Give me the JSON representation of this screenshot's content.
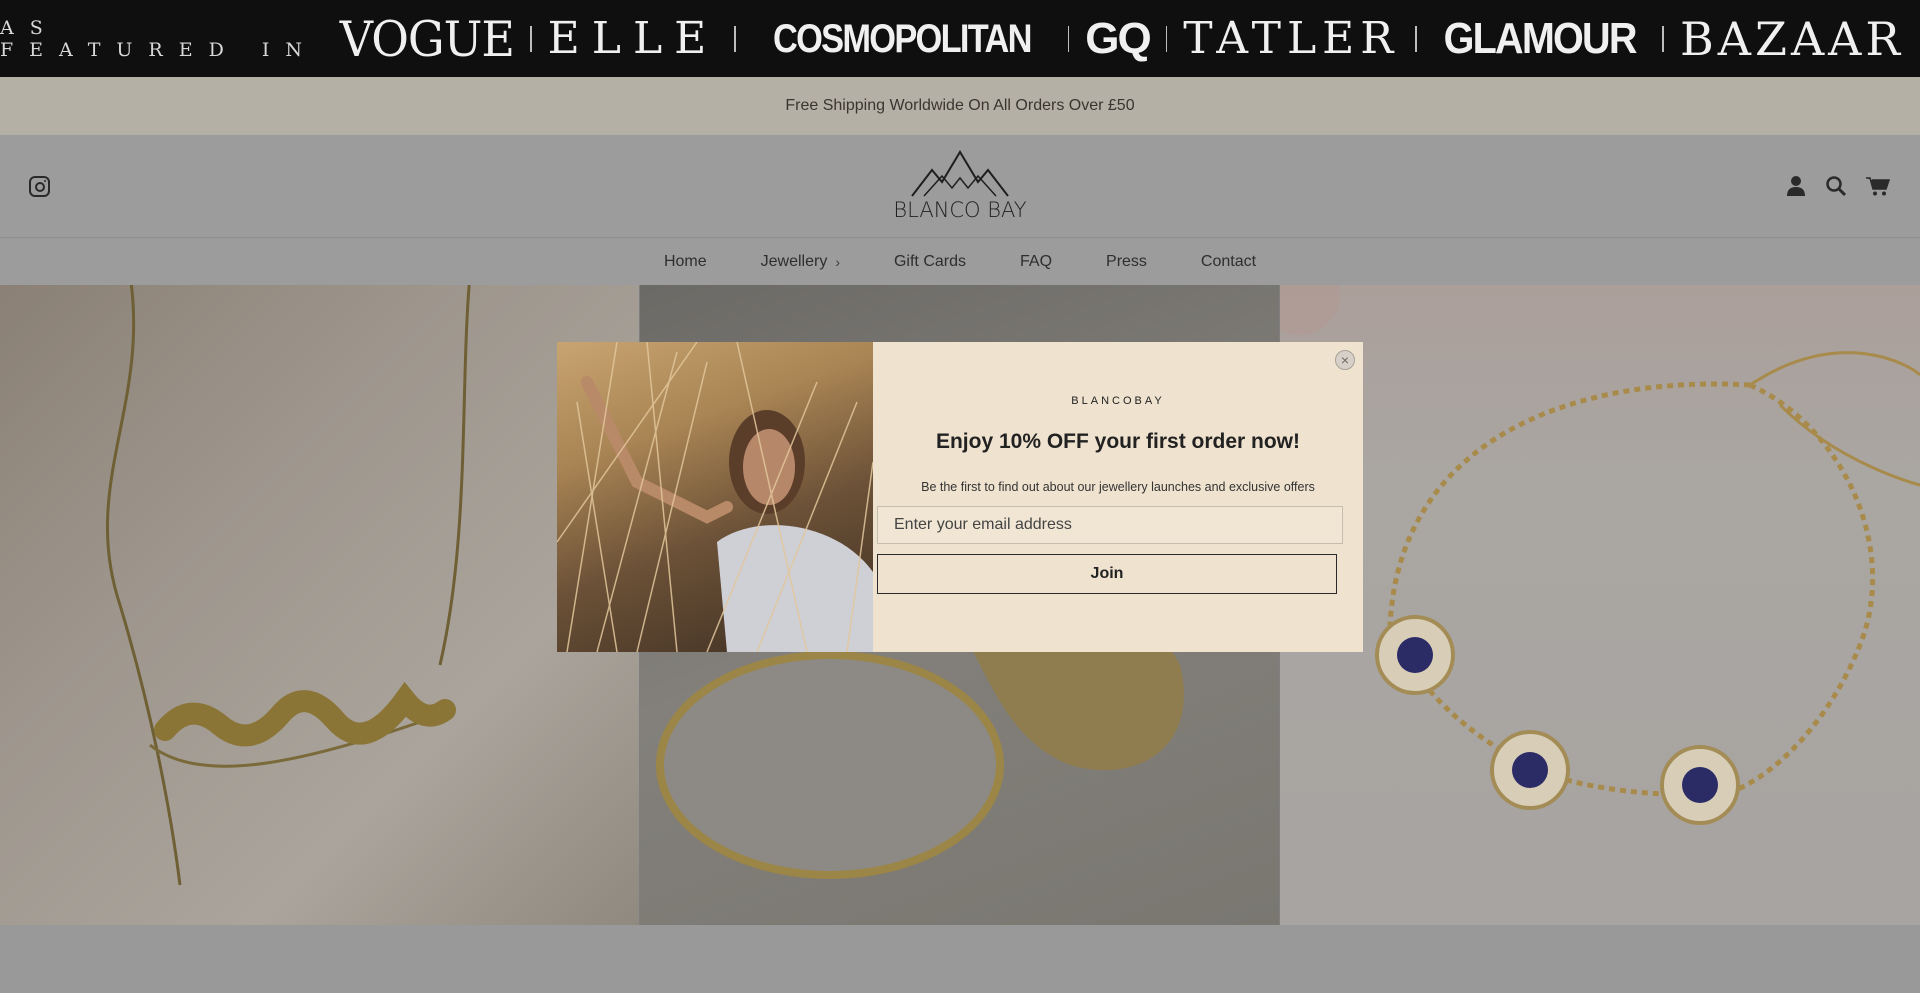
{
  "featured": {
    "prefix": "AS FEATURED IN",
    "logos": [
      "VOGUE",
      "ELLE",
      "COSMOPOLITAN",
      "GQ",
      "TATLER",
      "GLAMOUR",
      "BAZAAR"
    ]
  },
  "announcement": {
    "text": "Free Shipping Worldwide On All Orders Over £50"
  },
  "header": {
    "brand_name": "BLANCO BAY",
    "icons": [
      "instagram-icon",
      "account-icon",
      "search-icon",
      "cart-icon"
    ]
  },
  "nav": {
    "items": [
      {
        "label": "Home"
      },
      {
        "label": "Jewellery"
      },
      {
        "label": "Gift Cards"
      },
      {
        "label": "FAQ"
      },
      {
        "label": "Press"
      },
      {
        "label": "Contact"
      }
    ]
  },
  "modal": {
    "brand": "BLANCOBAY",
    "heading": "Enjoy 10% OFF your first order now!",
    "subtext": "Be the first to find out about our jewellery launches and exclusive offers",
    "email_placeholder": "Enter your email address",
    "join_label": "Join",
    "close_label": "×"
  },
  "colors": {
    "banner_bg": "#0f0f0f",
    "modal_bg": "#efe3cf",
    "page_dim": "#9c9c9c"
  }
}
